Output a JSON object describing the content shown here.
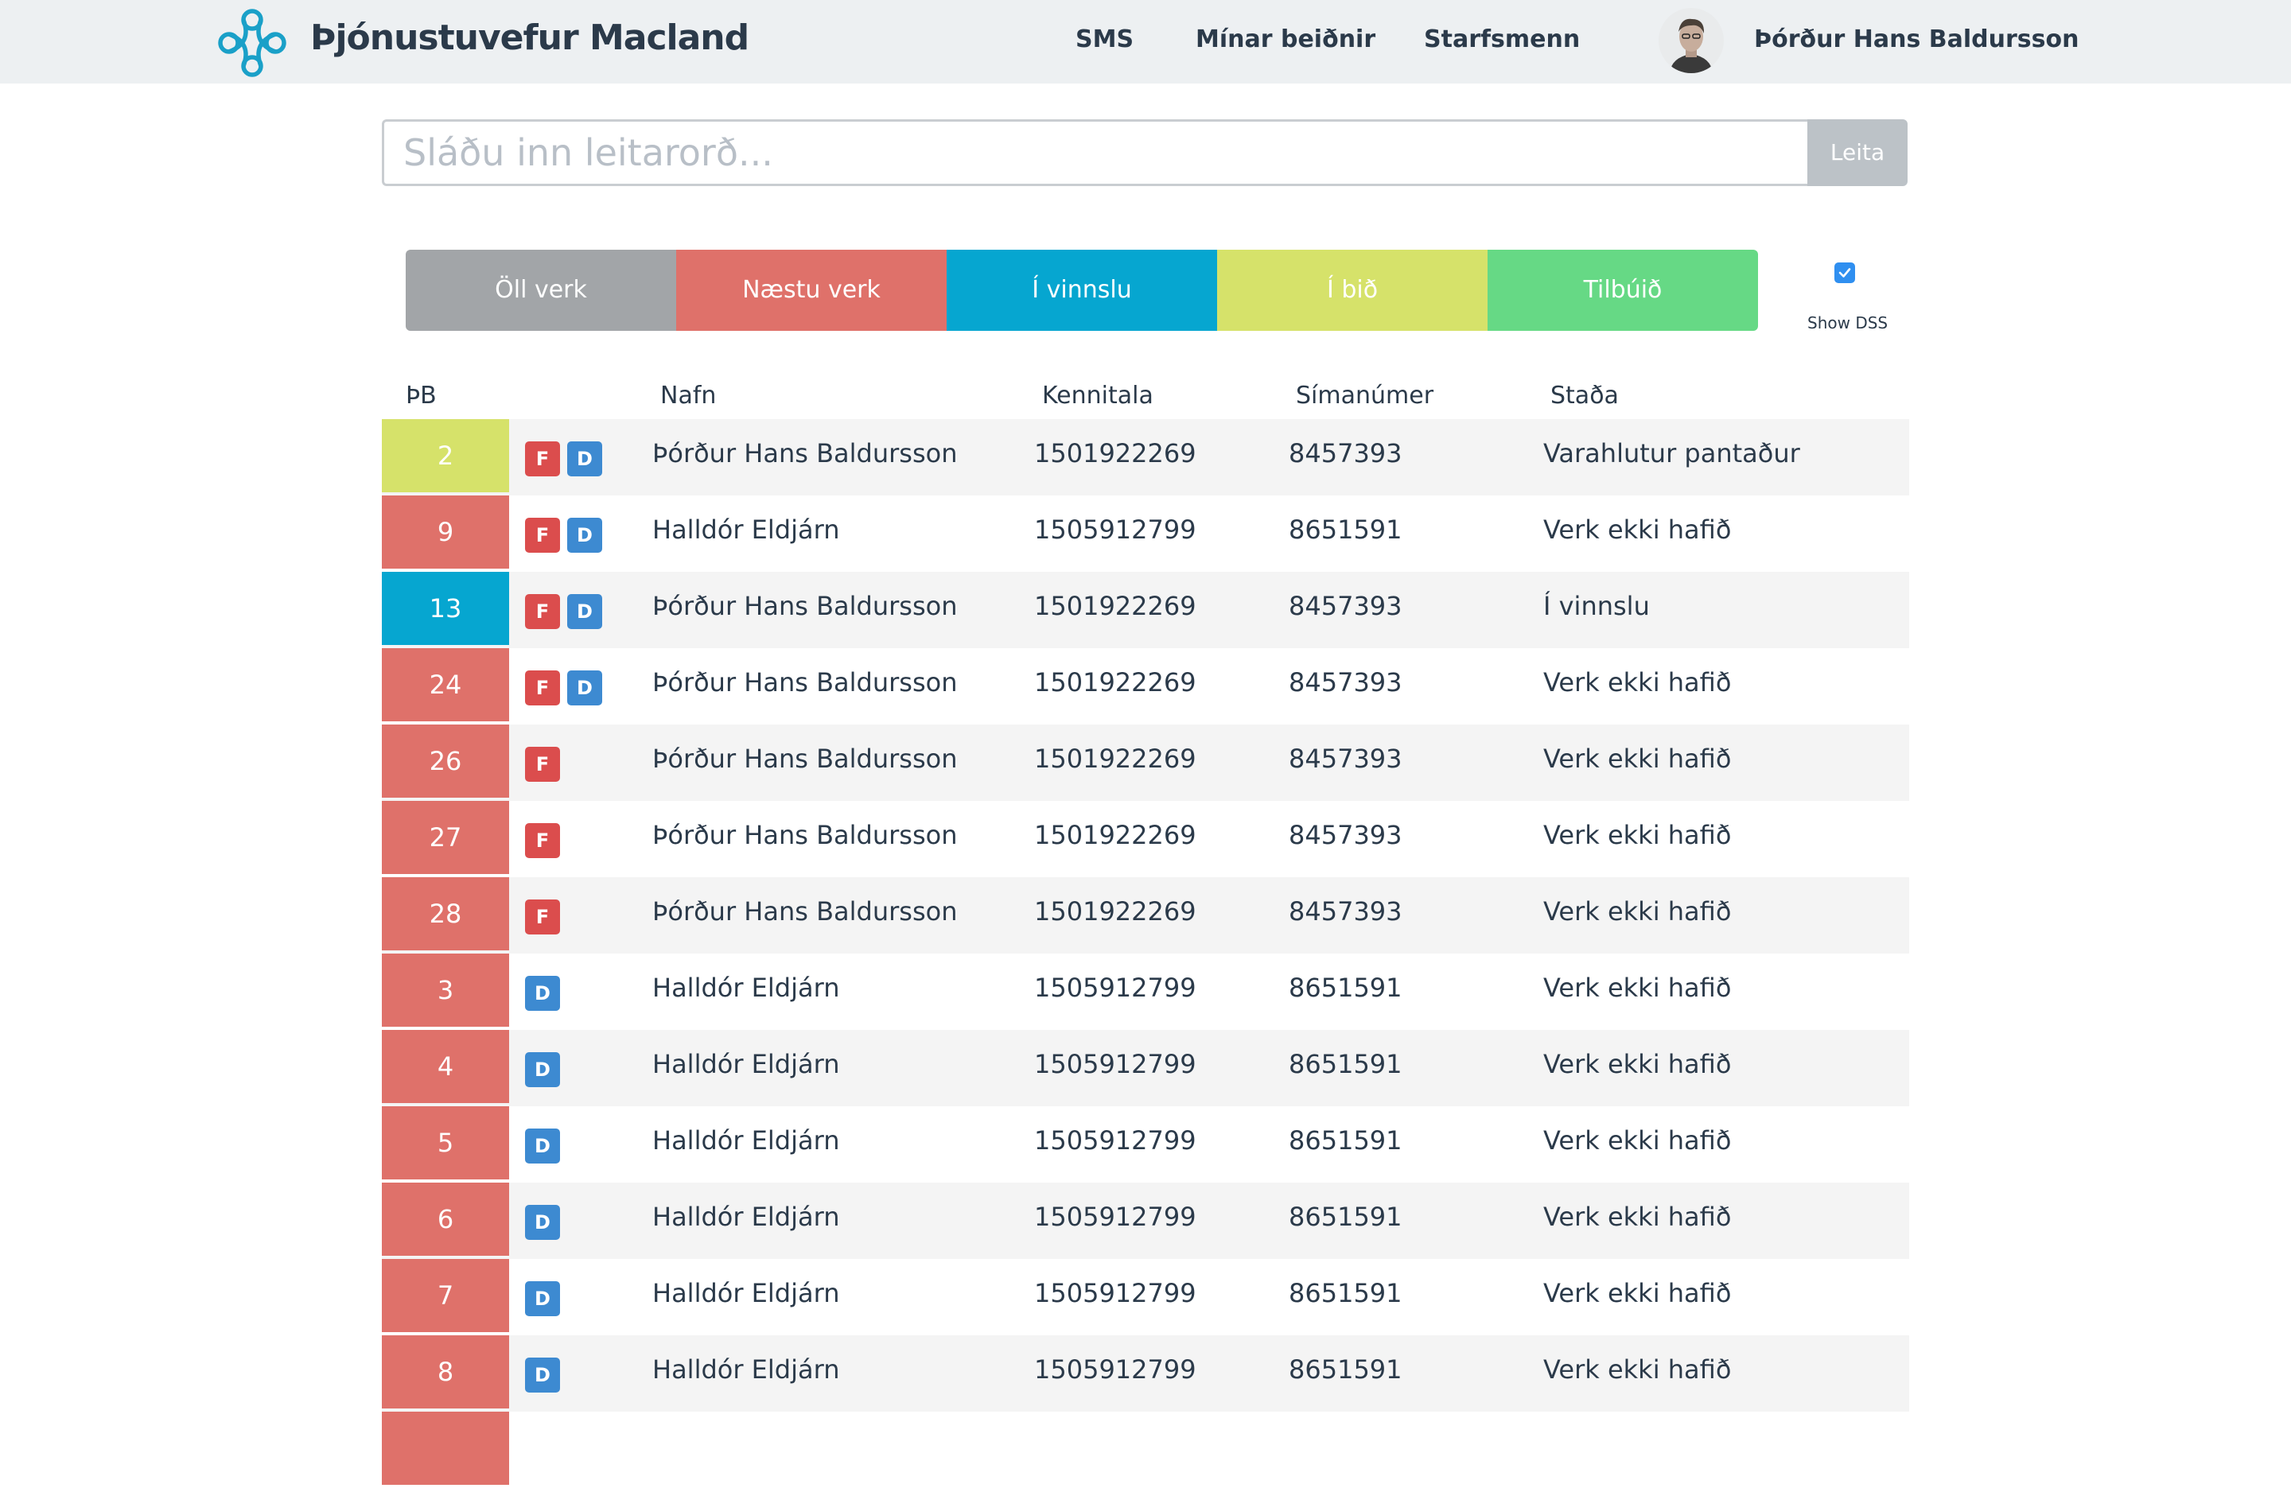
{
  "header": {
    "brand": "Þjónustuvefur Macland",
    "nav": [
      "SMS",
      "Mínar beiðnir",
      "Starfsmenn"
    ],
    "user_name": "Þórður Hans Baldursson"
  },
  "search": {
    "placeholder": "Sláðu inn leitarorð...",
    "button_label": "Leita"
  },
  "filters": [
    {
      "label": "Öll verk",
      "color": "#a2a5a8"
    },
    {
      "label": "Næstu verk",
      "color": "#df716a"
    },
    {
      "label": "Í vinnslu",
      "color": "#06a6d0"
    },
    {
      "label": "Í bið",
      "color": "#d6e26a"
    },
    {
      "label": "Tilbúið",
      "color": "#66d985"
    }
  ],
  "show_dss": {
    "label": "Show DSS",
    "checked": true
  },
  "colors": {
    "accent": "#1aa0c8",
    "yellow": "#d6e26a",
    "red": "#df716a",
    "blue": "#06a6d0"
  },
  "table": {
    "headers": [
      "ÞB",
      "Nafn",
      "Kennitala",
      "Símanúmer",
      "Staða"
    ],
    "rows": [
      {
        "num": "2",
        "status_color": "#d6e26a",
        "badges": [
          "F",
          "D"
        ],
        "name": "Þórður Hans Baldursson",
        "kt": "1501922269",
        "phone": "8457393",
        "status": "Varahlutur pantaður"
      },
      {
        "num": "9",
        "status_color": "#df716a",
        "badges": [
          "F",
          "D"
        ],
        "name": "Halldór Eldjárn",
        "kt": "1505912799",
        "phone": "8651591",
        "status": "Verk ekki hafið"
      },
      {
        "num": "13",
        "status_color": "#06a6d0",
        "badges": [
          "F",
          "D"
        ],
        "name": "Þórður Hans Baldursson",
        "kt": "1501922269",
        "phone": "8457393",
        "status": "Í vinnslu"
      },
      {
        "num": "24",
        "status_color": "#df716a",
        "badges": [
          "F",
          "D"
        ],
        "name": "Þórður Hans Baldursson",
        "kt": "1501922269",
        "phone": "8457393",
        "status": "Verk ekki hafið"
      },
      {
        "num": "26",
        "status_color": "#df716a",
        "badges": [
          "F"
        ],
        "name": "Þórður Hans Baldursson",
        "kt": "1501922269",
        "phone": "8457393",
        "status": "Verk ekki hafið"
      },
      {
        "num": "27",
        "status_color": "#df716a",
        "badges": [
          "F"
        ],
        "name": "Þórður Hans Baldursson",
        "kt": "1501922269",
        "phone": "8457393",
        "status": "Verk ekki hafið"
      },
      {
        "num": "28",
        "status_color": "#df716a",
        "badges": [
          "F"
        ],
        "name": "Þórður Hans Baldursson",
        "kt": "1501922269",
        "phone": "8457393",
        "status": "Verk ekki hafið"
      },
      {
        "num": "3",
        "status_color": "#df716a",
        "badges": [
          "D"
        ],
        "name": "Halldór Eldjárn",
        "kt": "1505912799",
        "phone": "8651591",
        "status": "Verk ekki hafið"
      },
      {
        "num": "4",
        "status_color": "#df716a",
        "badges": [
          "D"
        ],
        "name": "Halldór Eldjárn",
        "kt": "1505912799",
        "phone": "8651591",
        "status": "Verk ekki hafið"
      },
      {
        "num": "5",
        "status_color": "#df716a",
        "badges": [
          "D"
        ],
        "name": "Halldór Eldjárn",
        "kt": "1505912799",
        "phone": "8651591",
        "status": "Verk ekki hafið"
      },
      {
        "num": "6",
        "status_color": "#df716a",
        "badges": [
          "D"
        ],
        "name": "Halldór Eldjárn",
        "kt": "1505912799",
        "phone": "8651591",
        "status": "Verk ekki hafið"
      },
      {
        "num": "7",
        "status_color": "#df716a",
        "badges": [
          "D"
        ],
        "name": "Halldór Eldjárn",
        "kt": "1505912799",
        "phone": "8651591",
        "status": "Verk ekki hafið"
      },
      {
        "num": "8",
        "status_color": "#df716a",
        "badges": [
          "D"
        ],
        "name": "Halldór Eldjárn",
        "kt": "1505912799",
        "phone": "8651591",
        "status": "Verk ekki hafið"
      },
      {
        "num": "",
        "status_color": "#df716a",
        "badges": [],
        "name": "",
        "kt": "",
        "phone": "",
        "status": ""
      }
    ]
  }
}
